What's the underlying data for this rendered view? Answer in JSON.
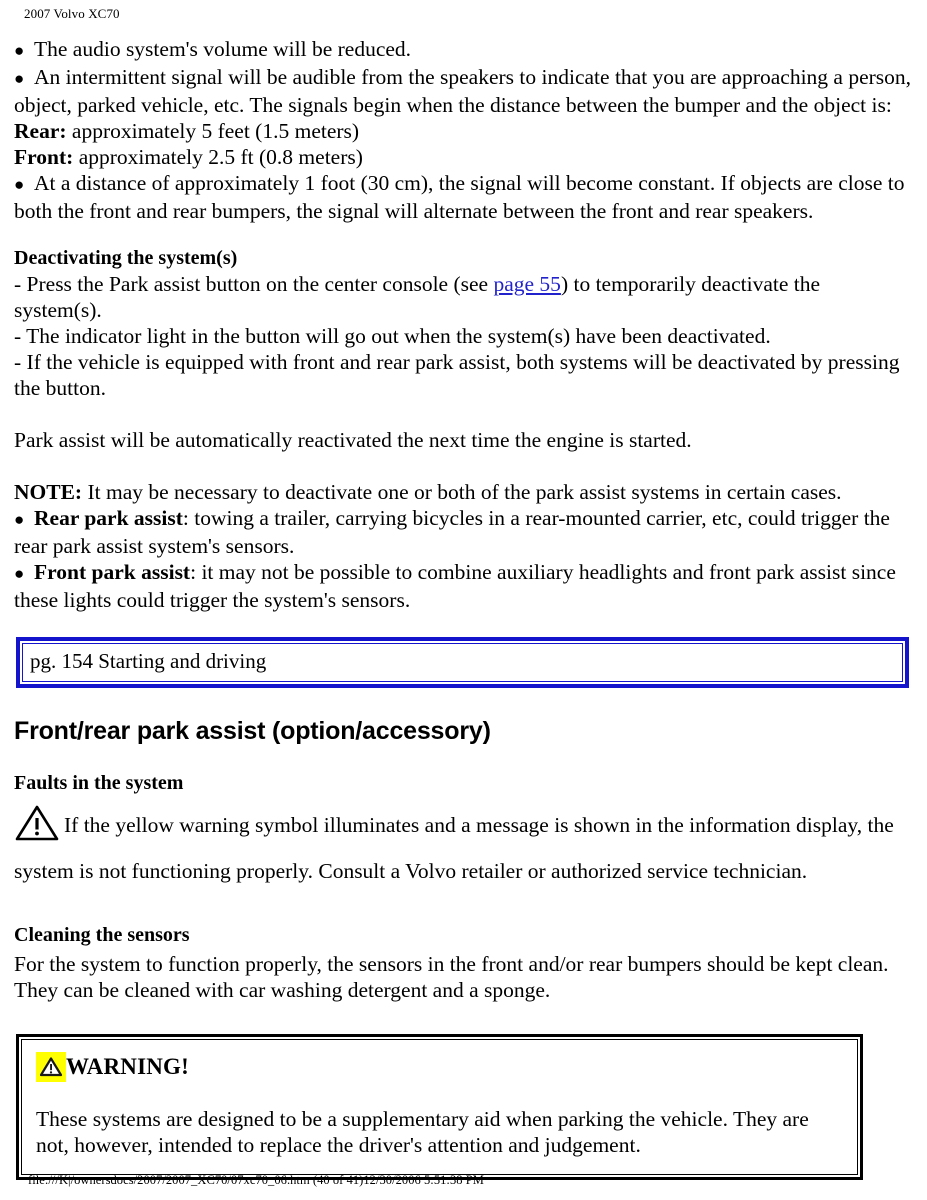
{
  "header": {
    "title": "2007 Volvo XC70"
  },
  "content": {
    "bullet1": "The audio system's volume will be reduced.",
    "bullet2": "An intermittent signal will be audible from the speakers to indicate that you are approaching a person, object, parked vehicle, etc. The signals begin when the distance between the bumper and the object is:",
    "rear_label": "Rear:",
    "rear_value": " approximately 5 feet (1.5 meters)",
    "front_label": "Front:",
    "front_value": " approximately 2.5 ft (0.8 meters)",
    "bullet3": "At a distance of approximately 1 foot (30 cm), the signal will become constant. If objects are close to both the front and rear bumpers, the signal will alternate between the front and rear speakers.",
    "deactivating_heading": "Deactivating the system(s)",
    "deact_line1_a": "- Press the Park assist button on the center console (see ",
    "deact_link": "page 55",
    "deact_line1_b": ") to temporarily deactivate the system(s).",
    "deact_line2": "- The indicator light in the button will go out when the system(s) have been deactivated.",
    "deact_line3": "- If the vehicle is equipped with front and rear park assist, both systems will be deactivated by pressing the button.",
    "reactivate_para": "Park assist will be automatically reactivated the next time the engine is started.",
    "note_label": "NOTE:",
    "note_text": " It may be necessary to deactivate one or both of the park assist systems in certain cases.",
    "note_bullet1_label": "Rear park assist",
    "note_bullet1_text": ": towing a trailer, carrying bicycles in a rear-mounted carrier, etc, could trigger the rear park assist system's sensors.",
    "note_bullet2_label": "Front park assist",
    "note_bullet2_text": ": it may not be possible to combine auxiliary headlights and front park assist since these lights could trigger the system's sensors.",
    "bullet_glyph": "●"
  },
  "page_nav_box": {
    "label": "pg. 154 Starting and driving",
    "border_color": "#1414cc"
  },
  "section": {
    "main_heading": "Front/rear park assist (option/accessory)",
    "faults_heading": "Faults in the system",
    "faults_text": "If the yellow warning symbol illuminates and a message is shown in the information display, the system is not functioning properly. Consult a Volvo retailer or authorized service technician.",
    "cleaning_heading": "Cleaning the sensors",
    "cleaning_text": "For the system to function properly, the sensors in the front and/or rear bumpers should be kept clean. They can be cleaned with car washing detergent and a sponge."
  },
  "warning_box": {
    "title": "WARNING!",
    "body": "These systems are designed to be a supplementary aid when parking the vehicle. They are not, however, intended to replace the driver's attention and judgement.",
    "badge_color": "#ffff00",
    "border_color": "#000000"
  },
  "footer": {
    "text": "file:///K|/ownersdocs/2007/2007_XC70/07xc70_06.htm (40 of 41)12/30/2006 5:51:38 PM"
  }
}
